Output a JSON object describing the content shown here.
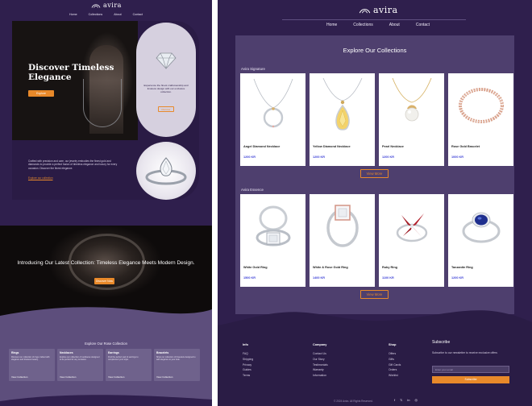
{
  "brand": {
    "name": "avira"
  },
  "left_preview": {
    "nav": [
      "Home",
      "Collections",
      "About",
      "Contact"
    ],
    "hero": {
      "title": "Discover Timeless Elegance",
      "cta": "Explore",
      "description": "Crafted with precision and care, our jewelry embodies the finest gold and diamonds to provide a perfect fusion of timeless elegance and luxury for every occasion. Discover the finest elegance.",
      "link": "Explore our collection"
    },
    "side_card": {
      "text": "Experience the finest craftsmanship and timeless design with our exclusive collection.",
      "cta": "Discover"
    },
    "collection_banner": {
      "text": "Introducing Our Latest Collection: Timeless Elegance Meets Modern Design.",
      "cta": "Discover Now"
    },
    "explore": {
      "title": "Explore Our Rose Collection",
      "categories": [
        {
          "title": "Rings",
          "text": "Discover our collection of rings crafted with elegance and timeless beauty.",
          "link": "View Collection"
        },
        {
          "title": "Necklaces",
          "text": "Explore our collection of necklaces designed to be perfect for any occasion.",
          "link": "View Collection"
        },
        {
          "title": "Earrings",
          "text": "Find the perfect pair of earrings to complement your style.",
          "link": "View Collection"
        },
        {
          "title": "Bracelets",
          "text": "Shop our collection of bracelets designed to add elegance to your look.",
          "link": "View Collection"
        }
      ]
    }
  },
  "header": {
    "nav": [
      "Home",
      "Collections",
      "About",
      "Contact"
    ]
  },
  "main": {
    "title": "Explore Our Collections",
    "sections": [
      {
        "label": "Avira Signature",
        "products": [
          {
            "name": "Angel Diamond Necklace",
            "price": "1200 KR"
          },
          {
            "name": "Yellow Diamond Necklace",
            "price": "1200 KR"
          },
          {
            "name": "Pearl Necklace",
            "price": "1200 KR"
          },
          {
            "name": "Rose Gold Bracelet",
            "price": "1000 KR"
          }
        ],
        "view_more": "View More"
      },
      {
        "label": "Avira Essence",
        "products": [
          {
            "name": "White Gold Ring",
            "price": "1500 KR"
          },
          {
            "name": "White & Rose Gold Ring",
            "price": "1400 KR"
          },
          {
            "name": "Ruby Ring",
            "price": "1100 KR"
          },
          {
            "name": "Tanzanite Ring",
            "price": "1200 KR"
          }
        ],
        "view_more": "View More"
      }
    ]
  },
  "footer": {
    "columns": [
      {
        "title": "Info",
        "links": [
          "FAQ",
          "Shipping",
          "Privacy",
          "Guides",
          "Terms"
        ]
      },
      {
        "title": "Company",
        "links": [
          "Contact Us",
          "Our Story",
          "Testimonials",
          "Warranty",
          "Information"
        ]
      },
      {
        "title": "Shop",
        "links": [
          "Offers",
          "Gifts",
          "Gift Cards",
          "Orders",
          "Wishlist"
        ]
      }
    ],
    "subscribe": {
      "title": "Subscribe",
      "text": "Subscribe to our newsletter to receive exclusive offers",
      "placeholder": "Enter your email",
      "button": "Subscribe"
    },
    "social": [
      "f",
      "𝕏",
      "in",
      "◎"
    ],
    "copyright": "© 2024 Avira. All Rights Reserved."
  },
  "colors": {
    "background": "#2f1f4d",
    "panel": "#4e3f6e",
    "accent": "#e8892a",
    "price": "#3b3fd6"
  }
}
